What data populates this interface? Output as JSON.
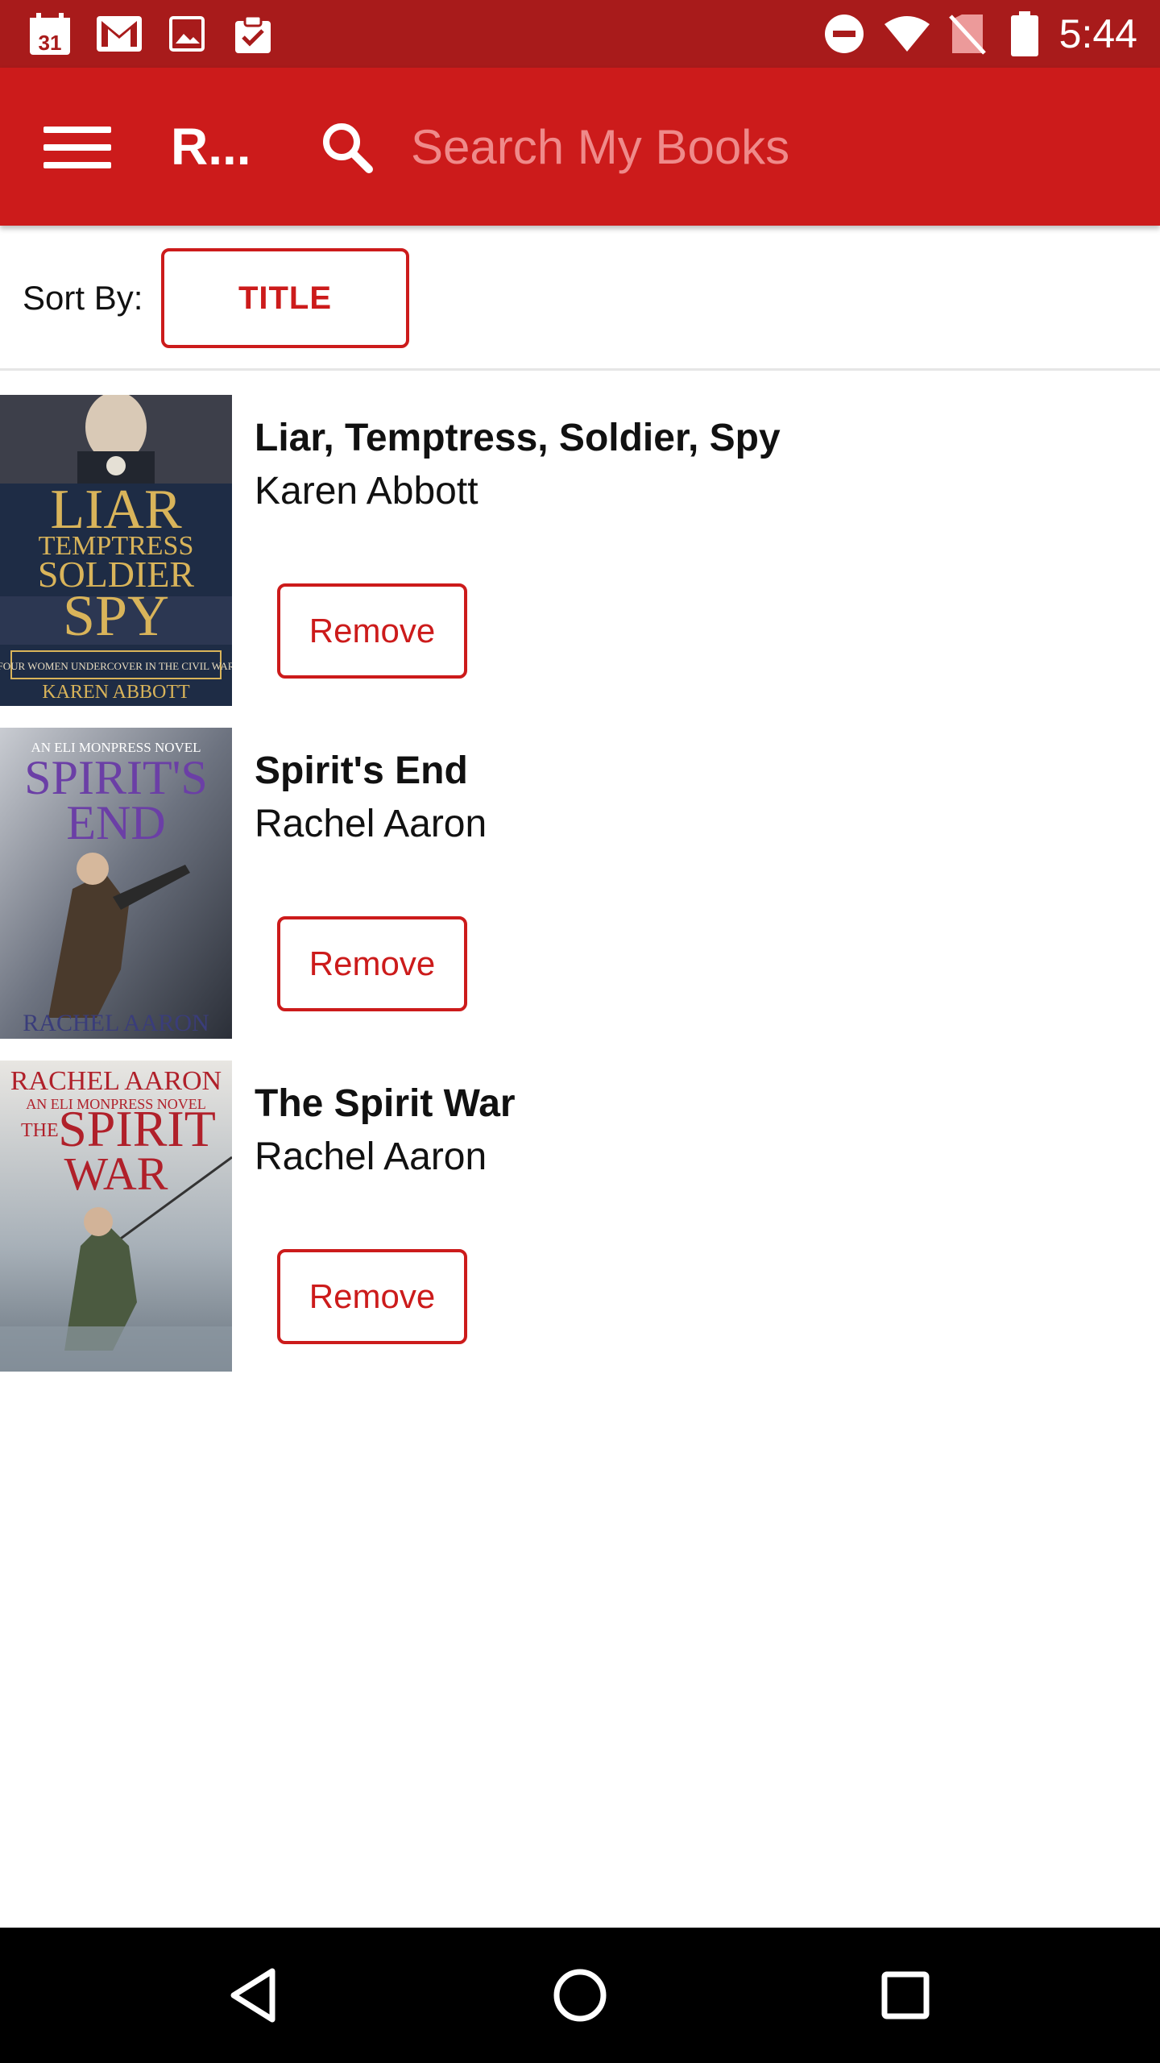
{
  "status_bar": {
    "time": "5:44",
    "calendar_day": "31",
    "left_icons": [
      "calendar-icon",
      "gmail-icon",
      "image-icon",
      "clipboard-check-icon"
    ],
    "right_icons": [
      "do-not-disturb-icon",
      "wifi-icon",
      "no-sim-icon",
      "battery-icon"
    ]
  },
  "app_bar": {
    "title": "R...",
    "search_placeholder": "Search My Books",
    "color": "#cc1b1b"
  },
  "sort": {
    "label": "Sort By:",
    "button_label": "TITLE"
  },
  "books": [
    {
      "title": "Liar, Temptress, Soldier, Spy",
      "author": "Karen Abbott",
      "remove_label": "Remove",
      "cover": {
        "lines": [
          "LIAR",
          "TEMPTRESS",
          "SOLDIER",
          "SPY"
        ],
        "subtitle": "FOUR WOMEN UNDERCOVER IN THE CIVIL WAR",
        "author": "KAREN ABBOTT"
      }
    },
    {
      "title": "Spirit's End",
      "author": "Rachel Aaron",
      "remove_label": "Remove",
      "cover": {
        "series": "AN ELI MONPRESS NOVEL",
        "lines": [
          "SPIRIT'S",
          "END"
        ],
        "author": "RACHEL AARON"
      }
    },
    {
      "title": "The Spirit War",
      "author": "Rachel Aaron",
      "remove_label": "Remove",
      "cover": {
        "author": "RACHEL AARON",
        "series": "AN ELI MONPRESS NOVEL",
        "lines": [
          "THE",
          "SPIRIT",
          "WAR"
        ]
      }
    }
  ],
  "nav_bar": {
    "buttons": [
      "back-icon",
      "home-icon",
      "recents-icon"
    ]
  }
}
